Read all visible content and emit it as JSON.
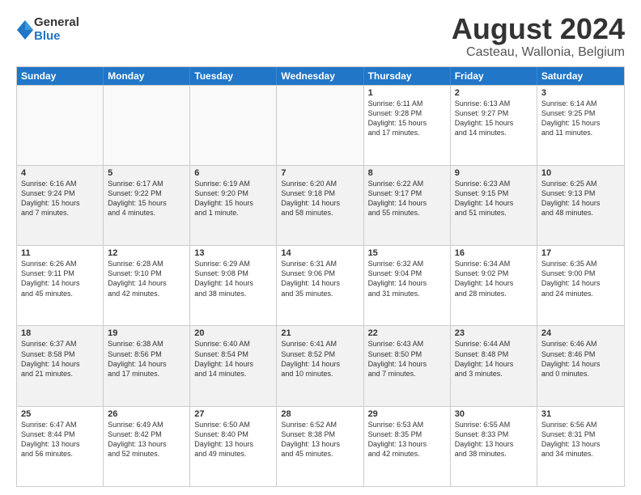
{
  "logo": {
    "general": "General",
    "blue": "Blue"
  },
  "title": {
    "month_year": "August 2024",
    "location": "Casteau, Wallonia, Belgium"
  },
  "header_days": [
    "Sunday",
    "Monday",
    "Tuesday",
    "Wednesday",
    "Thursday",
    "Friday",
    "Saturday"
  ],
  "weeks": [
    [
      {
        "day": "",
        "text": "",
        "empty": true
      },
      {
        "day": "",
        "text": "",
        "empty": true
      },
      {
        "day": "",
        "text": "",
        "empty": true
      },
      {
        "day": "",
        "text": "",
        "empty": true
      },
      {
        "day": "1",
        "text": "Sunrise: 6:11 AM\nSunset: 9:28 PM\nDaylight: 15 hours\nand 17 minutes.",
        "empty": false
      },
      {
        "day": "2",
        "text": "Sunrise: 6:13 AM\nSunset: 9:27 PM\nDaylight: 15 hours\nand 14 minutes.",
        "empty": false
      },
      {
        "day": "3",
        "text": "Sunrise: 6:14 AM\nSunset: 9:25 PM\nDaylight: 15 hours\nand 11 minutes.",
        "empty": false
      }
    ],
    [
      {
        "day": "4",
        "text": "Sunrise: 6:16 AM\nSunset: 9:24 PM\nDaylight: 15 hours\nand 7 minutes.",
        "empty": false
      },
      {
        "day": "5",
        "text": "Sunrise: 6:17 AM\nSunset: 9:22 PM\nDaylight: 15 hours\nand 4 minutes.",
        "empty": false
      },
      {
        "day": "6",
        "text": "Sunrise: 6:19 AM\nSunset: 9:20 PM\nDaylight: 15 hours\nand 1 minute.",
        "empty": false
      },
      {
        "day": "7",
        "text": "Sunrise: 6:20 AM\nSunset: 9:18 PM\nDaylight: 14 hours\nand 58 minutes.",
        "empty": false
      },
      {
        "day": "8",
        "text": "Sunrise: 6:22 AM\nSunset: 9:17 PM\nDaylight: 14 hours\nand 55 minutes.",
        "empty": false
      },
      {
        "day": "9",
        "text": "Sunrise: 6:23 AM\nSunset: 9:15 PM\nDaylight: 14 hours\nand 51 minutes.",
        "empty": false
      },
      {
        "day": "10",
        "text": "Sunrise: 6:25 AM\nSunset: 9:13 PM\nDaylight: 14 hours\nand 48 minutes.",
        "empty": false
      }
    ],
    [
      {
        "day": "11",
        "text": "Sunrise: 6:26 AM\nSunset: 9:11 PM\nDaylight: 14 hours\nand 45 minutes.",
        "empty": false
      },
      {
        "day": "12",
        "text": "Sunrise: 6:28 AM\nSunset: 9:10 PM\nDaylight: 14 hours\nand 42 minutes.",
        "empty": false
      },
      {
        "day": "13",
        "text": "Sunrise: 6:29 AM\nSunset: 9:08 PM\nDaylight: 14 hours\nand 38 minutes.",
        "empty": false
      },
      {
        "day": "14",
        "text": "Sunrise: 6:31 AM\nSunset: 9:06 PM\nDaylight: 14 hours\nand 35 minutes.",
        "empty": false
      },
      {
        "day": "15",
        "text": "Sunrise: 6:32 AM\nSunset: 9:04 PM\nDaylight: 14 hours\nand 31 minutes.",
        "empty": false
      },
      {
        "day": "16",
        "text": "Sunrise: 6:34 AM\nSunset: 9:02 PM\nDaylight: 14 hours\nand 28 minutes.",
        "empty": false
      },
      {
        "day": "17",
        "text": "Sunrise: 6:35 AM\nSunset: 9:00 PM\nDaylight: 14 hours\nand 24 minutes.",
        "empty": false
      }
    ],
    [
      {
        "day": "18",
        "text": "Sunrise: 6:37 AM\nSunset: 8:58 PM\nDaylight: 14 hours\nand 21 minutes.",
        "empty": false
      },
      {
        "day": "19",
        "text": "Sunrise: 6:38 AM\nSunset: 8:56 PM\nDaylight: 14 hours\nand 17 minutes.",
        "empty": false
      },
      {
        "day": "20",
        "text": "Sunrise: 6:40 AM\nSunset: 8:54 PM\nDaylight: 14 hours\nand 14 minutes.",
        "empty": false
      },
      {
        "day": "21",
        "text": "Sunrise: 6:41 AM\nSunset: 8:52 PM\nDaylight: 14 hours\nand 10 minutes.",
        "empty": false
      },
      {
        "day": "22",
        "text": "Sunrise: 6:43 AM\nSunset: 8:50 PM\nDaylight: 14 hours\nand 7 minutes.",
        "empty": false
      },
      {
        "day": "23",
        "text": "Sunrise: 6:44 AM\nSunset: 8:48 PM\nDaylight: 14 hours\nand 3 minutes.",
        "empty": false
      },
      {
        "day": "24",
        "text": "Sunrise: 6:46 AM\nSunset: 8:46 PM\nDaylight: 14 hours\nand 0 minutes.",
        "empty": false
      }
    ],
    [
      {
        "day": "25",
        "text": "Sunrise: 6:47 AM\nSunset: 8:44 PM\nDaylight: 13 hours\nand 56 minutes.",
        "empty": false
      },
      {
        "day": "26",
        "text": "Sunrise: 6:49 AM\nSunset: 8:42 PM\nDaylight: 13 hours\nand 52 minutes.",
        "empty": false
      },
      {
        "day": "27",
        "text": "Sunrise: 6:50 AM\nSunset: 8:40 PM\nDaylight: 13 hours\nand 49 minutes.",
        "empty": false
      },
      {
        "day": "28",
        "text": "Sunrise: 6:52 AM\nSunset: 8:38 PM\nDaylight: 13 hours\nand 45 minutes.",
        "empty": false
      },
      {
        "day": "29",
        "text": "Sunrise: 6:53 AM\nSunset: 8:35 PM\nDaylight: 13 hours\nand 42 minutes.",
        "empty": false
      },
      {
        "day": "30",
        "text": "Sunrise: 6:55 AM\nSunset: 8:33 PM\nDaylight: 13 hours\nand 38 minutes.",
        "empty": false
      },
      {
        "day": "31",
        "text": "Sunrise: 6:56 AM\nSunset: 8:31 PM\nDaylight: 13 hours\nand 34 minutes.",
        "empty": false
      }
    ]
  ]
}
